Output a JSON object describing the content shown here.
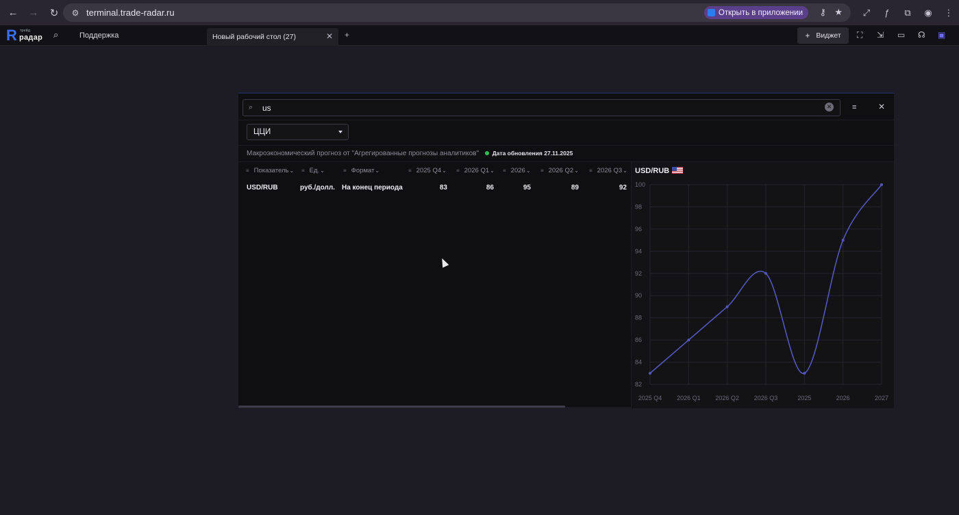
{
  "browser": {
    "back_icon": "arrow-left-icon",
    "url": "terminal.trade-radar.ru",
    "open_in_app": "Открыть в приложении"
  },
  "header": {
    "brand_small": "трейд",
    "brand_word": "радар",
    "support": "Поддержка",
    "tab_label": "Новый рабочий стол (27)",
    "widget_label": "Виджет"
  },
  "search": {
    "value": "us"
  },
  "select": {
    "value": "ЦЦИ"
  },
  "source": {
    "text": "Макроэкономический прогноз от \"Агрегированные прогнозы аналитиков\"",
    "updated": "Дата обновления 27.11.2025",
    "status_color": "#2fbf55"
  },
  "table": {
    "headers": [
      "Показатель",
      "Ед.",
      "Формат",
      "2025 Q4",
      "2026 Q1",
      "2026",
      "2026 Q2",
      "2026 Q3"
    ],
    "row": {
      "indicator": "USD/RUB",
      "unit": "руб./долл.",
      "format": "На конец периода",
      "v2025q4": "83",
      "v2026q1": "86",
      "v2026": "95",
      "v2026q2": "89",
      "v2026q3": "92"
    }
  },
  "chart_title": "USD/RUB",
  "chart_data": {
    "type": "line",
    "title": "USD/RUB",
    "categories": [
      "2025 Q4",
      "2026 Q1",
      "2026 Q2",
      "2026 Q3",
      "2025",
      "2026",
      "2027"
    ],
    "values": [
      83,
      86,
      89,
      92,
      83,
      95,
      100
    ],
    "ylim": [
      82,
      100
    ],
    "yticks": [
      82,
      84,
      86,
      88,
      90,
      92,
      94,
      96,
      98,
      100
    ],
    "grid": true,
    "color": "#5457b8"
  }
}
